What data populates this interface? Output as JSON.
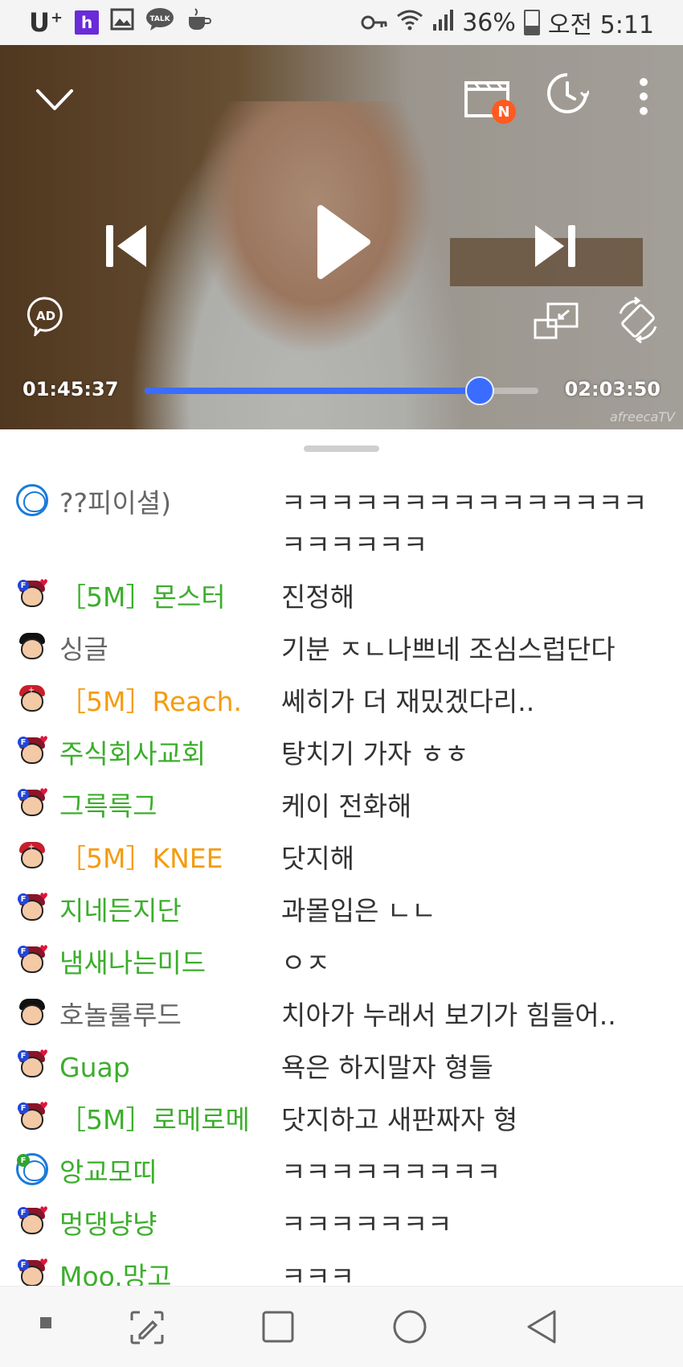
{
  "status_bar": {
    "carrier": "U",
    "carrier_sup": "+",
    "h_label": "h",
    "battery_percent": "36%",
    "battery_level": 0.36,
    "clock": "오전 5:11"
  },
  "player": {
    "clapper_badge": "N",
    "ad_label": "AD",
    "current_time": "01:45:37",
    "total_time": "02:03:50",
    "progress": 0.852,
    "watermark": "afreecaTV"
  },
  "chat": [
    {
      "avatar": "panda",
      "nick": "??피이셜)",
      "nick_color": "gray",
      "msg": "ㅋㅋㅋㅋㅋㅋㅋㅋㅋㅋㅋㅋㅋㅋㅋㅋㅋㅋㅋㅋㅋ"
    },
    {
      "avatar": "fan",
      "nick": "［5M］몬스터",
      "nick_color": "green",
      "msg": "진정해"
    },
    {
      "avatar": "plain",
      "nick": "싱글",
      "nick_color": "gray",
      "msg": "기분 ㅈㄴ나쁘네 조심스럽단다"
    },
    {
      "avatar": "sub",
      "nick": "［5M］Reach.",
      "nick_color": "orange",
      "msg": "쎄히가 더 재밌겠다리.."
    },
    {
      "avatar": "fan",
      "nick": "주식회사교회",
      "nick_color": "green",
      "msg": "탕치기 가자 ㅎㅎ"
    },
    {
      "avatar": "fan",
      "nick": "그륵륵그",
      "nick_color": "green",
      "msg": "케이 전화해"
    },
    {
      "avatar": "sub",
      "nick": "［5M］KNEE",
      "nick_color": "orange",
      "msg": "닷지해"
    },
    {
      "avatar": "fan",
      "nick": "지네든지단",
      "nick_color": "green",
      "msg": "과몰입은 ㄴㄴ"
    },
    {
      "avatar": "fan",
      "nick": "냄새나는미드",
      "nick_color": "green",
      "msg": "ㅇㅈ"
    },
    {
      "avatar": "plain",
      "nick": "호놀룰루드",
      "nick_color": "gray",
      "msg": "치아가 누래서 보기가 힘들어.."
    },
    {
      "avatar": "fan",
      "nick": "Guap",
      "nick_color": "green",
      "msg": "욕은 하지말자 형들"
    },
    {
      "avatar": "fan",
      "nick": "［5M］로메로메",
      "nick_color": "green",
      "msg": "닷지하고 새판짜자 형"
    },
    {
      "avatar": "panda-green",
      "nick": "앙교모띠",
      "nick_color": "green",
      "msg": "ㅋㅋㅋㅋㅋㅋㅋㅋㅋ"
    },
    {
      "avatar": "fan",
      "nick": "멍댕냥냥",
      "nick_color": "green",
      "msg": "ㅋㅋㅋㅋㅋㅋㅋ"
    },
    {
      "avatar": "fan",
      "nick": "Moo.망고",
      "nick_color": "green",
      "msg": "ㅋㅋㅋ"
    }
  ],
  "colors": {
    "seek_accent": "#3a6dff",
    "nick_green": "#3cae2c",
    "nick_orange": "#f49c10",
    "nick_gray": "#666666",
    "badge_orange": "#ff5a1f"
  },
  "icons": {
    "collapse": "chevron-down-icon",
    "vod_list": "clapperboard-icon",
    "history": "clock-history-icon",
    "more": "more-vertical-icon",
    "prev": "skip-previous-icon",
    "play": "play-icon",
    "next": "skip-next-icon",
    "audio_desc": "ad-icon",
    "pip": "picture-in-picture-icon",
    "rotate": "screen-rotate-icon"
  }
}
